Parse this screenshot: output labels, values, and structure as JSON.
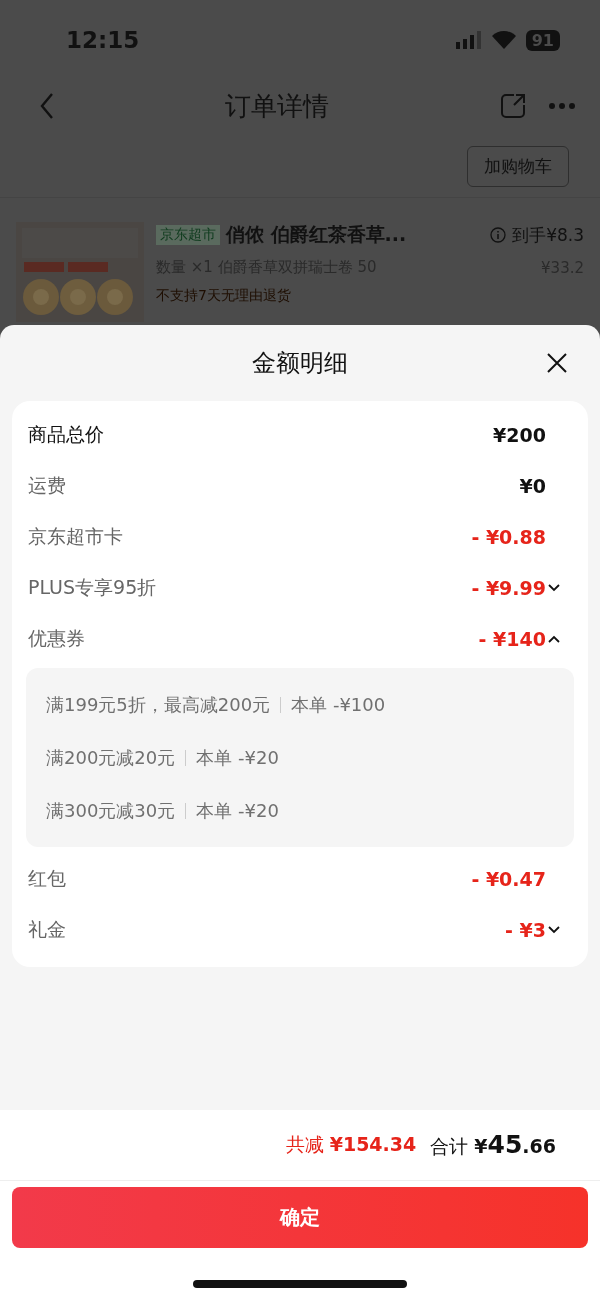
{
  "status_bar": {
    "time": "12:15",
    "battery": "91"
  },
  "page": {
    "title": "订单详情",
    "cart_button": "加购物车",
    "product": {
      "store_tag": "京东超市",
      "title": "俏侬 伯爵红茶香草...",
      "final_price": "到手¥8.3",
      "spec": "数量 ×1  伯爵香草双拼瑞士卷 50",
      "original_price": "¥33.2",
      "note": "不支持7天无理由退货"
    }
  },
  "sheet": {
    "title": "金额明细",
    "rows": [
      {
        "label": "商品总价",
        "value": "¥200",
        "kind": "charge",
        "strong": true
      },
      {
        "label": "运费",
        "value": "¥0",
        "kind": "charge",
        "strong": false
      },
      {
        "label": "京东超市卡",
        "value": "- ¥0.88",
        "kind": "discount",
        "strong": false
      },
      {
        "label": "PLUS专享95折",
        "value": "- ¥9.99",
        "kind": "discount",
        "strong": false,
        "expanded": false
      },
      {
        "label": "优惠券",
        "value": "- ¥140",
        "kind": "discount",
        "strong": false,
        "expanded": true,
        "details": [
          {
            "condition": "满199元5折，最高减200元",
            "applied": "本单 -¥100"
          },
          {
            "condition": "满200元减20元",
            "applied": "本单 -¥20"
          },
          {
            "condition": "满300元减30元",
            "applied": "本单 -¥20"
          }
        ]
      },
      {
        "label": "红包",
        "value": "- ¥0.47",
        "kind": "discount",
        "strong": false
      },
      {
        "label": "礼金",
        "value": "- ¥3",
        "kind": "discount",
        "strong": false,
        "expanded": false
      }
    ],
    "total_discount": {
      "label": "共减",
      "value": "¥154.34"
    },
    "total": {
      "label": "合计",
      "value": "¥45.66"
    },
    "confirm_button": "确定"
  }
}
